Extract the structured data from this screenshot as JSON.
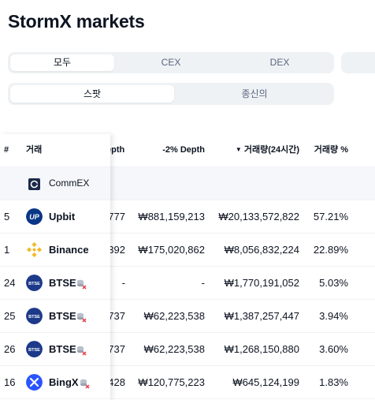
{
  "page": {
    "title": "StormX markets"
  },
  "market_type_tabs": [
    {
      "label": "모두",
      "active": true
    },
    {
      "label": "CEX",
      "active": false
    },
    {
      "label": "DEX",
      "active": false
    }
  ],
  "product_tabs": [
    {
      "label": "스팟",
      "active": true
    },
    {
      "label": "종신의",
      "active": false
    }
  ],
  "table": {
    "headers": {
      "rank": "#",
      "exchange": "거래",
      "plus_depth": "epth",
      "minus_depth": "-2% Depth",
      "volume": "거래량(24시간)",
      "volume_pct": "거래량 %"
    },
    "sponsored_row": {
      "name": "CommEX"
    },
    "rows": [
      {
        "rank": "5",
        "name": "Upbit",
        "logo": "upbit-logo",
        "warning": false,
        "plus_depth": "777",
        "minus_depth": "₩881,159,213",
        "volume": "₩20,133,572,822",
        "volume_pct": "57.21%"
      },
      {
        "rank": "1",
        "name": "Binance",
        "logo": "binance-logo",
        "warning": false,
        "plus_depth": "392",
        "minus_depth": "₩175,020,862",
        "volume": "₩8,056,832,224",
        "volume_pct": "22.89%"
      },
      {
        "rank": "24",
        "name": "BTSE",
        "logo": "btse-logo",
        "warning": true,
        "plus_depth": "-",
        "minus_depth": "-",
        "volume": "₩1,770,191,052",
        "volume_pct": "5.03%"
      },
      {
        "rank": "25",
        "name": "BTSE",
        "logo": "btse-logo",
        "warning": true,
        "plus_depth": "737",
        "minus_depth": "₩62,223,538",
        "volume": "₩1,387,257,447",
        "volume_pct": "3.94%"
      },
      {
        "rank": "26",
        "name": "BTSE",
        "logo": "btse-logo",
        "warning": true,
        "plus_depth": "737",
        "minus_depth": "₩62,223,538",
        "volume": "₩1,268,150,880",
        "volume_pct": "3.60%"
      },
      {
        "rank": "16",
        "name": "BingX",
        "logo": "bingx-logo",
        "warning": true,
        "plus_depth": "428",
        "minus_depth": "₩120,775,223",
        "volume": "₩645,124,199",
        "volume_pct": "1.83%"
      }
    ]
  },
  "colors": {
    "text": "#0d1421",
    "muted": "#58667e",
    "tab_bg": "#eff2f5",
    "upbit": "#093687",
    "binance": "#f3ba2f",
    "btse": "#1d3a8a",
    "bingx": "#2a54ff",
    "warning_red": "#ea3943"
  }
}
